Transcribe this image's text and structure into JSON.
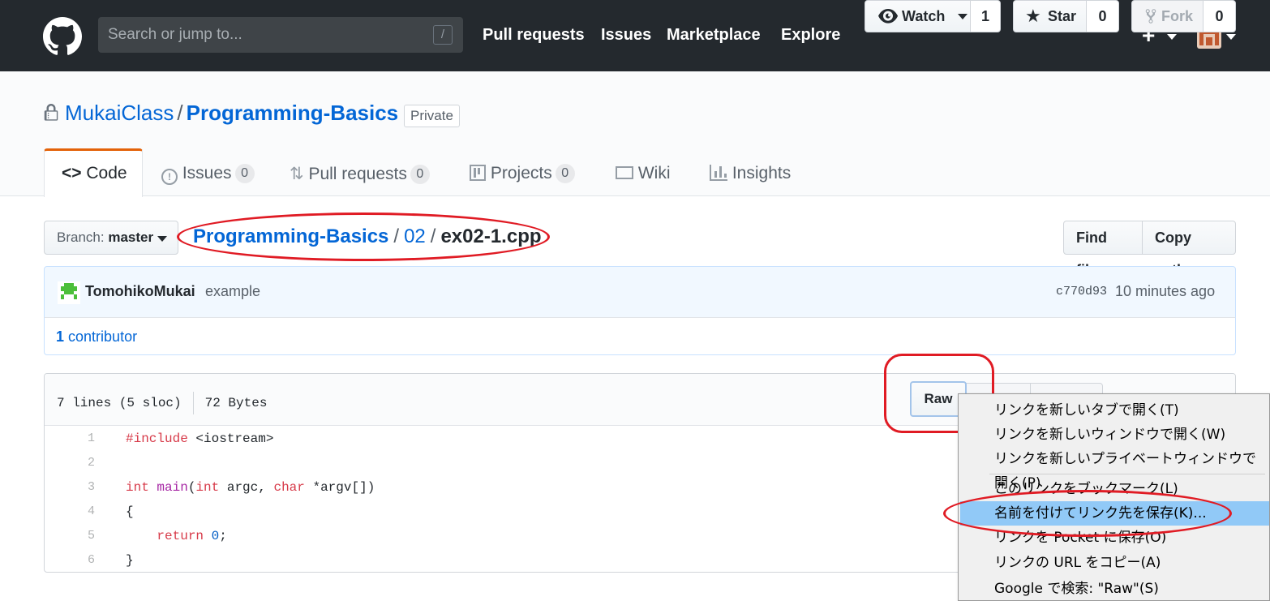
{
  "header": {
    "search_placeholder": "Search or jump to...",
    "slash_key": "/",
    "nav": [
      "Pull requests",
      "Issues",
      "Marketplace",
      "Explore"
    ],
    "plus": "+"
  },
  "repo": {
    "owner": "MukaiClass",
    "separator": "/",
    "name": "Programming-Basics",
    "visibility": "Private",
    "watch_label": "Watch",
    "watch_count": "1",
    "star_label": "Star",
    "star_count": "0",
    "fork_label": "Fork",
    "fork_count": "0"
  },
  "tabs": [
    {
      "label": "Code",
      "icon": "code-icon"
    },
    {
      "label": "Issues",
      "count": "0",
      "icon": "issue-icon"
    },
    {
      "label": "Pull requests",
      "count": "0",
      "icon": "git-pull-request-icon"
    },
    {
      "label": "Projects",
      "count": "0",
      "icon": "project-icon"
    },
    {
      "label": "Wiki",
      "icon": "book-icon"
    },
    {
      "label": "Insights",
      "icon": "graph-icon"
    }
  ],
  "file_nav": {
    "branch_label": "Branch:",
    "branch_name": "master",
    "crumb_repo": "Programming-Basics",
    "crumb_dir": "02",
    "crumb_file": "ex02-1.cpp",
    "find_file": "Find file",
    "copy_path": "Copy path"
  },
  "commit": {
    "author": "TomohikoMukai",
    "message": "example",
    "sha": "c770d93",
    "time": "10 minutes ago",
    "contributor_count": "1",
    "contributor_label": "contributor"
  },
  "file": {
    "lines_info": "7 lines (5 sloc)",
    "size": "72 Bytes",
    "raw_label": "Raw",
    "line_numbers": [
      "1",
      "2",
      "3",
      "4",
      "5",
      "6"
    ]
  },
  "context_menu": {
    "items": [
      "リンクを新しいタブで開く(T)",
      "リンクを新しいウィンドウで開く(W)",
      "リンクを新しいプライベートウィンドウで開く(P)",
      "このリンクをブックマーク(L)",
      "名前を付けてリンク先を保存(K)...",
      "リンクを Pocket に保存(O)",
      "リンクの URL をコピー(A)",
      "Google で検索: \"Raw\"(S)"
    ],
    "highlighted_index": 4
  }
}
